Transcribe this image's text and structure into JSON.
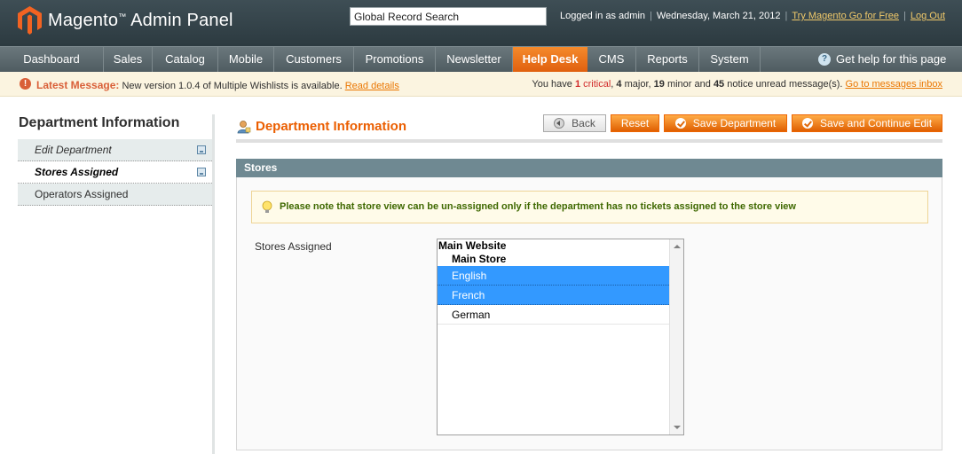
{
  "header": {
    "logo_text": "Magento",
    "logo_tm": "™",
    "logo_suffix": "Admin Panel",
    "search_value": "Global Record Search",
    "logged_in": "Logged in as admin",
    "date": "Wednesday, March 21, 2012",
    "try_link": "Try Magento Go for Free",
    "logout_link": "Log Out"
  },
  "nav": {
    "items": [
      "Dashboard",
      "Sales",
      "Catalog",
      "Mobile",
      "Customers",
      "Promotions",
      "Newsletter",
      "Help Desk",
      "CMS",
      "Reports",
      "System"
    ],
    "active": "Help Desk",
    "help": "Get help for this page"
  },
  "message": {
    "label": "Latest Message:",
    "text": "New version 1.0.4 of Multiple Wishlists is available.",
    "link": "Read details",
    "summary_prefix": "You have",
    "critical_count": "1",
    "critical_label": "critical",
    "major_count": "4",
    "major_label": "major,",
    "minor_count": "19",
    "minor_label": "minor and",
    "notice_count": "45",
    "notice_label": "notice unread message(s).",
    "inbox_link": "Go to messages inbox"
  },
  "sidebar": {
    "title": "Department Information",
    "tabs": [
      "Edit Department",
      "Stores Assigned",
      "Operators Assigned"
    ]
  },
  "main": {
    "title": "Department Information",
    "buttons": {
      "back": "Back",
      "reset": "Reset",
      "save": "Save Department",
      "save_continue": "Save and Continue Edit"
    },
    "section_title": "Stores",
    "notice": "Please note that store view can be un-assigned only if the department has no tickets assigned to the store view",
    "field_label": "Stores Assigned",
    "select": {
      "website": "Main Website",
      "store": "Main Store",
      "options": [
        "English",
        "French",
        "German"
      ],
      "selected": [
        "English",
        "French"
      ]
    }
  },
  "colors": {
    "accent": "#eb5e00",
    "selected": "#3399ff",
    "section_header": "#6f8992"
  }
}
